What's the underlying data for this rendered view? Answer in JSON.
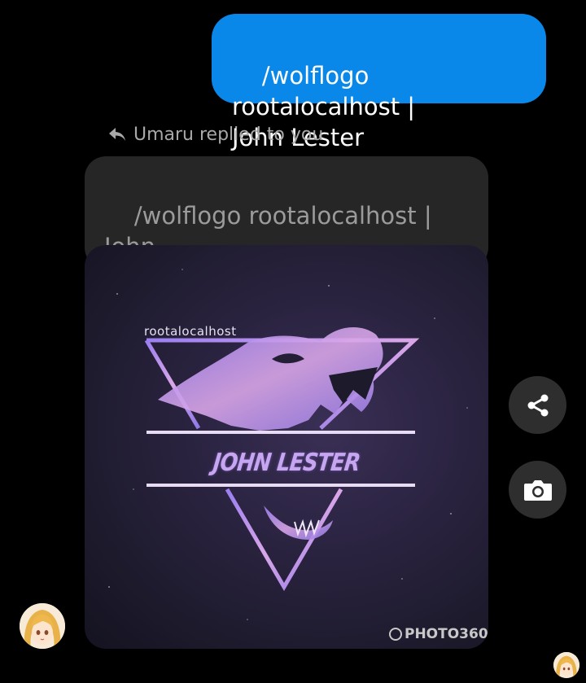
{
  "sent_message": {
    "text": "/wolflogo rootalocalhost |\nJohn Lester"
  },
  "reply_indicator": {
    "icon": "reply-arrow-icon",
    "text": "Umaru replied to you"
  },
  "quoted_message": {
    "text": "/wolflogo rootalocalhost | John\nLester"
  },
  "image_message": {
    "logo_handle": "rootalocalhost",
    "logo_name": "JOHN LESTER",
    "watermark": "PHOTO360"
  },
  "actions": {
    "share_icon": "share-icon",
    "camera_icon": "camera-icon"
  },
  "colors": {
    "sent_bubble": "#0a88ea",
    "quoted_bubble": "#262626",
    "background": "#000000",
    "action_button": "#2e2e2e"
  }
}
